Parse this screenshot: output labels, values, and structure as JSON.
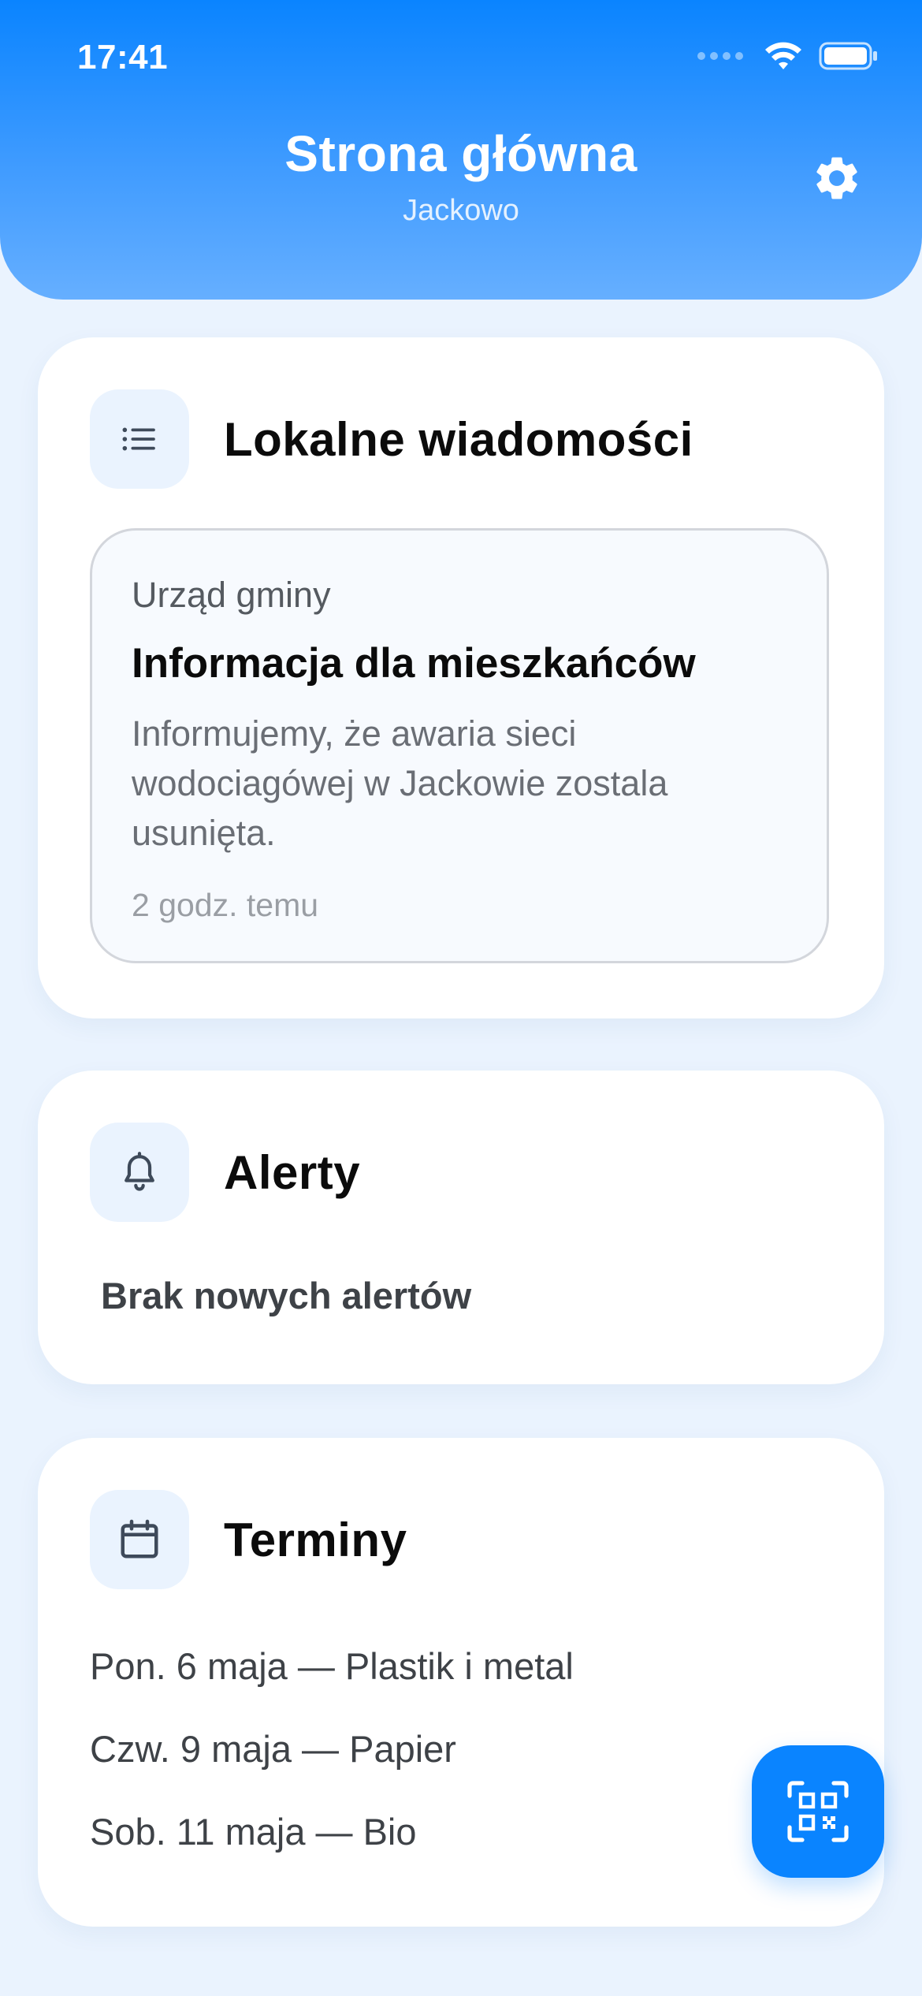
{
  "status_bar": {
    "time": "17:41",
    "wifi_icon": "wifi-icon",
    "battery_icon": "battery-icon"
  },
  "header": {
    "title": "Strona główna",
    "subtitle": "Jackowo",
    "settings_icon": "gear-icon"
  },
  "news": {
    "title": "Lokalne wiadomości",
    "icon": "list-icon",
    "items": [
      {
        "source": "Urząd gminy",
        "headline": "Informacja dla mieszkańców",
        "body": "Informujemy, że awaria sieci wodociagówej w Jackowie zostala usunięta.",
        "time": "2 godz. temu"
      }
    ]
  },
  "alerts": {
    "title": "Alerty",
    "icon": "bell-icon",
    "empty_text": "Brak nowych alertów"
  },
  "terms": {
    "title": "Terminy",
    "icon": "calendar-icon",
    "items": [
      "Pon. 6 maja — Plastik i metal",
      "Czw. 9 maja — Papier",
      "Sob. 11 maja — Bio"
    ]
  },
  "fab": {
    "icon": "qr-scan-icon"
  },
  "colors": {
    "accent": "#0A84FF",
    "background": "#EAF3FE",
    "card": "#FFFFFF"
  }
}
